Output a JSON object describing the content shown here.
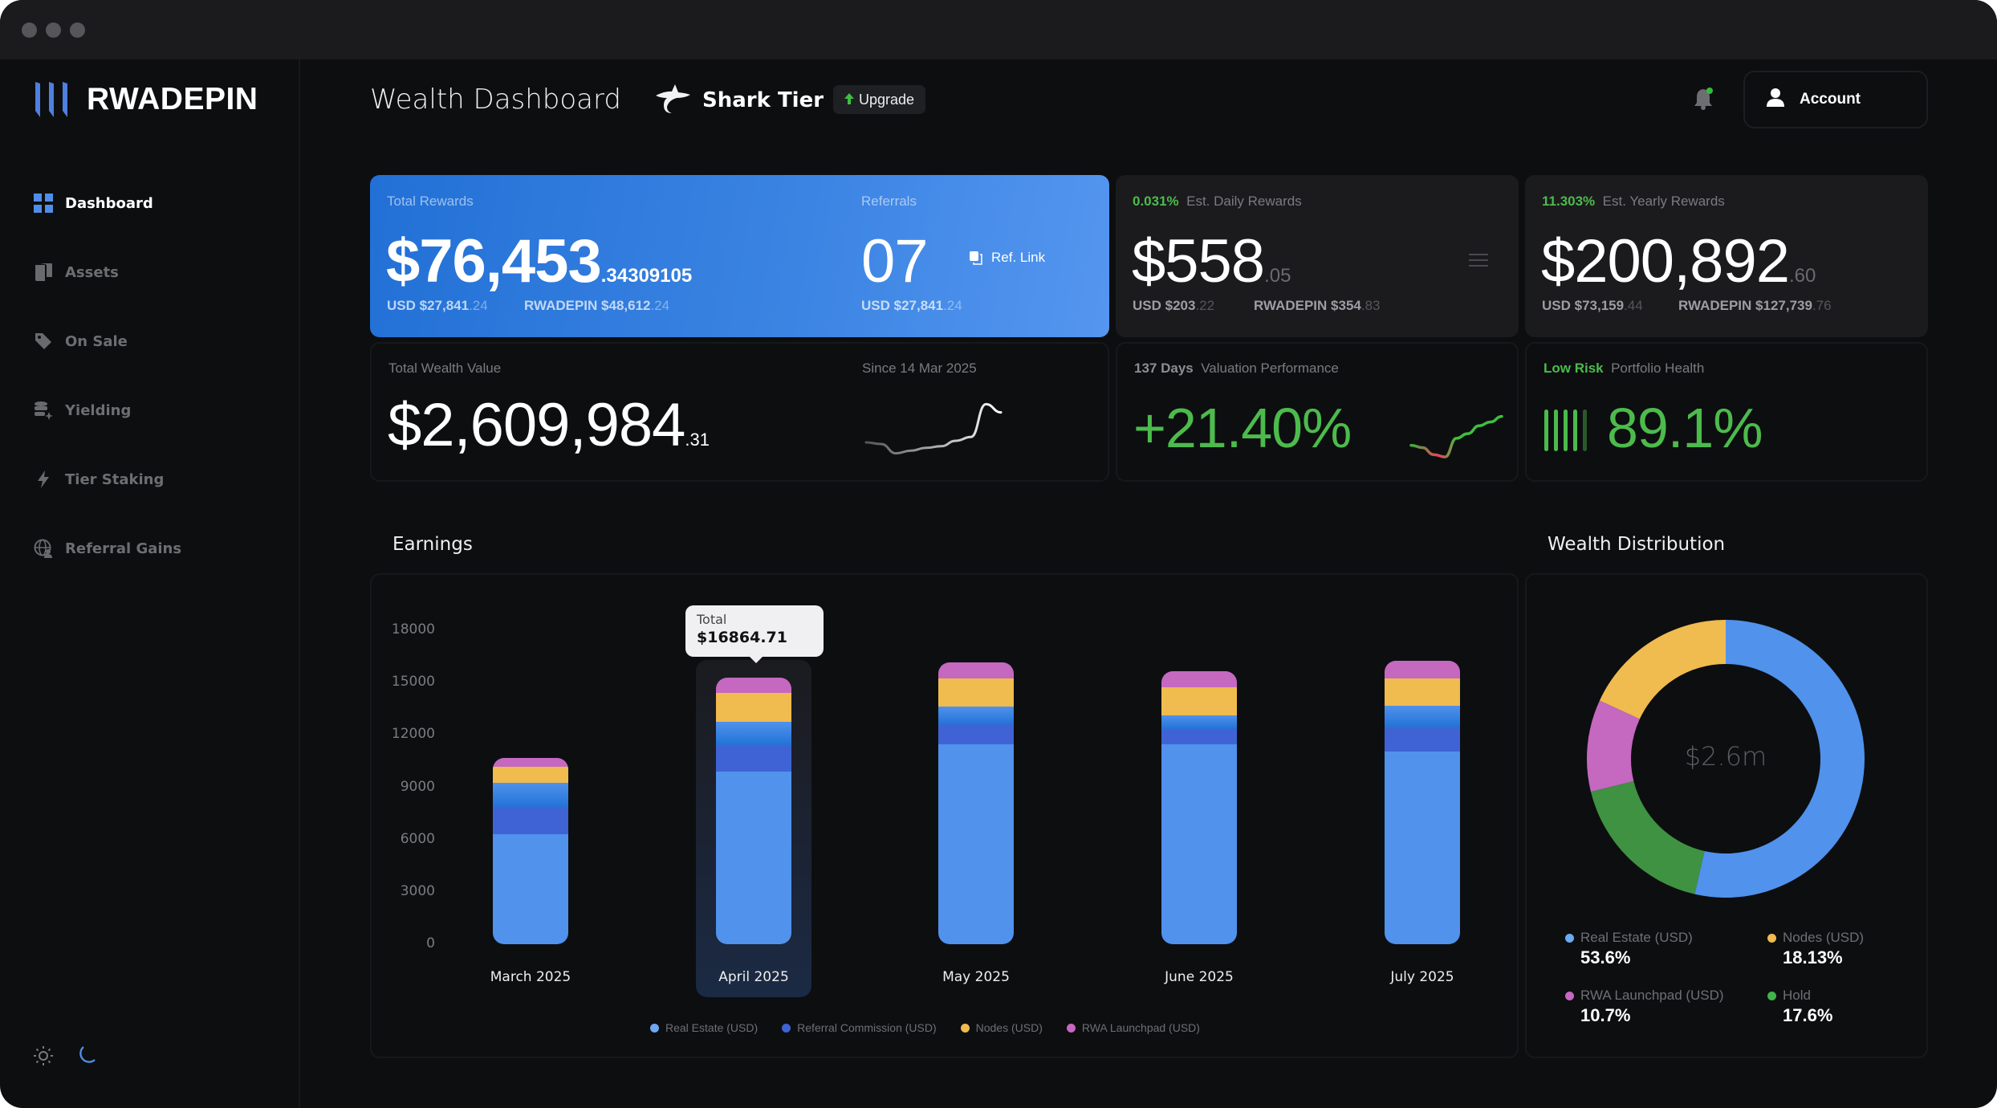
{
  "window": {
    "controls": [
      "close",
      "minimize",
      "maximize"
    ]
  },
  "brand": {
    "name": "RWADEPIN",
    "accent": "#4f8ee8"
  },
  "sidebar": {
    "items": [
      {
        "label": "Dashboard",
        "icon": "grid-icon",
        "active": true
      },
      {
        "label": "Assets",
        "icon": "assets-icon",
        "active": false
      },
      {
        "label": "On Sale",
        "icon": "tag-icon",
        "active": false
      },
      {
        "label": "Yielding",
        "icon": "database-sparkle-icon",
        "active": false
      },
      {
        "label": "Tier Staking",
        "icon": "lightning-icon",
        "active": false
      },
      {
        "label": "Referral Gains",
        "icon": "globe-user-icon",
        "active": false
      }
    ],
    "theme": {
      "light_icon": "sun-icon",
      "dark_icon": "moon-icon",
      "selected": "dark"
    }
  },
  "header": {
    "title": "Wealth Dashboard",
    "tier": "Shark Tier",
    "upgrade_label": "Upgrade",
    "account_label": "Account",
    "notification_dot": true
  },
  "cards": {
    "total_rewards": {
      "label": "Total Rewards",
      "value_main": "$76,453",
      "value_decimal": ".34309105",
      "usd_label": "USD $27,841",
      "usd_decimal": ".24",
      "token_label": "RWADEPIN $48,612",
      "token_decimal": ".24"
    },
    "referrals": {
      "label": "Referrals",
      "value": "07",
      "ref_link_label": "Ref. Link",
      "usd_label": "USD $27,841",
      "usd_decimal": ".24"
    },
    "daily": {
      "rate": "0.031%",
      "label": "Est. Daily Rewards",
      "value_main": "$558",
      "value_decimal": ".05",
      "usd_label": "USD $203",
      "usd_decimal": ".22",
      "token_label": "RWADEPIN $354",
      "token_decimal": ".83"
    },
    "yearly": {
      "rate": "11.303%",
      "label": "Est. Yearly Rewards",
      "value_main": "$200,892",
      "value_decimal": ".60",
      "usd_label": "USD $73,159",
      "usd_decimal": ".44",
      "token_label": "RWADEPIN $127,739",
      "token_decimal": ".76"
    },
    "wealth": {
      "label": "Total Wealth Value",
      "value_main": "$2,609,984",
      "value_decimal": ".31",
      "since": "Since 14 Mar 2025"
    },
    "performance": {
      "days": "137 Days",
      "label": "Valuation Performance",
      "value": "+21.40%"
    },
    "health": {
      "risk": "Low Risk",
      "label": "Portfolio Health",
      "value": "89.1%",
      "score_fraction": 0.891
    }
  },
  "earnings": {
    "title": "Earnings",
    "tooltip": {
      "label": "Total",
      "value": "$16864.71",
      "month": "April 2025"
    }
  },
  "distribution": {
    "title": "Wealth Distribution",
    "center_label": "$2.6m"
  },
  "chart_data": [
    {
      "type": "bar",
      "stacked": true,
      "title": "Earnings",
      "categories": [
        "March 2025",
        "April 2025",
        "May 2025",
        "June 2025",
        "July 2025"
      ],
      "series": [
        {
          "name": "Real Estate (USD)",
          "color": "#5092ec",
          "values": [
            6300,
            9900,
            11460,
            11460,
            11050
          ]
        },
        {
          "name": "Referral Commission (USD)",
          "color": "#3f63d4",
          "values": [
            2950,
            2850,
            2160,
            1660,
            2620
          ]
        },
        {
          "name": "Nodes (USD)",
          "color": "#f0bb4f",
          "values": [
            920,
            1660,
            1610,
            1610,
            1570
          ]
        },
        {
          "name": "RWA Launchpad (USD)",
          "color": "#c468c0",
          "values": [
            510,
            870,
            920,
            920,
            1010
          ]
        }
      ],
      "yticks": [
        0,
        3000,
        6000,
        9000,
        12000,
        15000,
        18000
      ],
      "ylim": [
        0,
        18000
      ],
      "highlighted": "April 2025",
      "legend": "bottom",
      "xlabel": "",
      "ylabel": ""
    },
    {
      "type": "pie",
      "donut": true,
      "title": "Wealth Distribution",
      "center_label": "$2.6m",
      "slices": [
        {
          "name": "Real Estate (USD)",
          "value": 53.6,
          "label": "53.6%",
          "color": "#5092ec"
        },
        {
          "name": "Hold",
          "value": 17.6,
          "label": "17.6%",
          "color": "#3e9241"
        },
        {
          "name": "RWA Launchpad (USD)",
          "value": 10.7,
          "label": "10.7%",
          "color": "#c468c0"
        },
        {
          "name": "Nodes (USD)",
          "value": 18.13,
          "label": "18.13%",
          "color": "#f0bb4f"
        }
      ],
      "legend_order": [
        "Real Estate (USD)",
        "Nodes (USD)",
        "RWA Launchpad (USD)",
        "Hold"
      ],
      "legend": "bottom"
    },
    {
      "type": "line",
      "title": "Total Wealth Value sparkline",
      "y": [
        0.25,
        0.22,
        0.05,
        0.1,
        0.15,
        0.18,
        0.28,
        0.35,
        0.95,
        0.8
      ],
      "ylim": [
        0,
        1
      ]
    },
    {
      "type": "line",
      "title": "Valuation Performance sparkline",
      "y": [
        0.3,
        0.25,
        0.1,
        0.05,
        0.45,
        0.55,
        0.72,
        0.8,
        0.92
      ],
      "ylim": [
        0,
        1
      ]
    }
  ]
}
